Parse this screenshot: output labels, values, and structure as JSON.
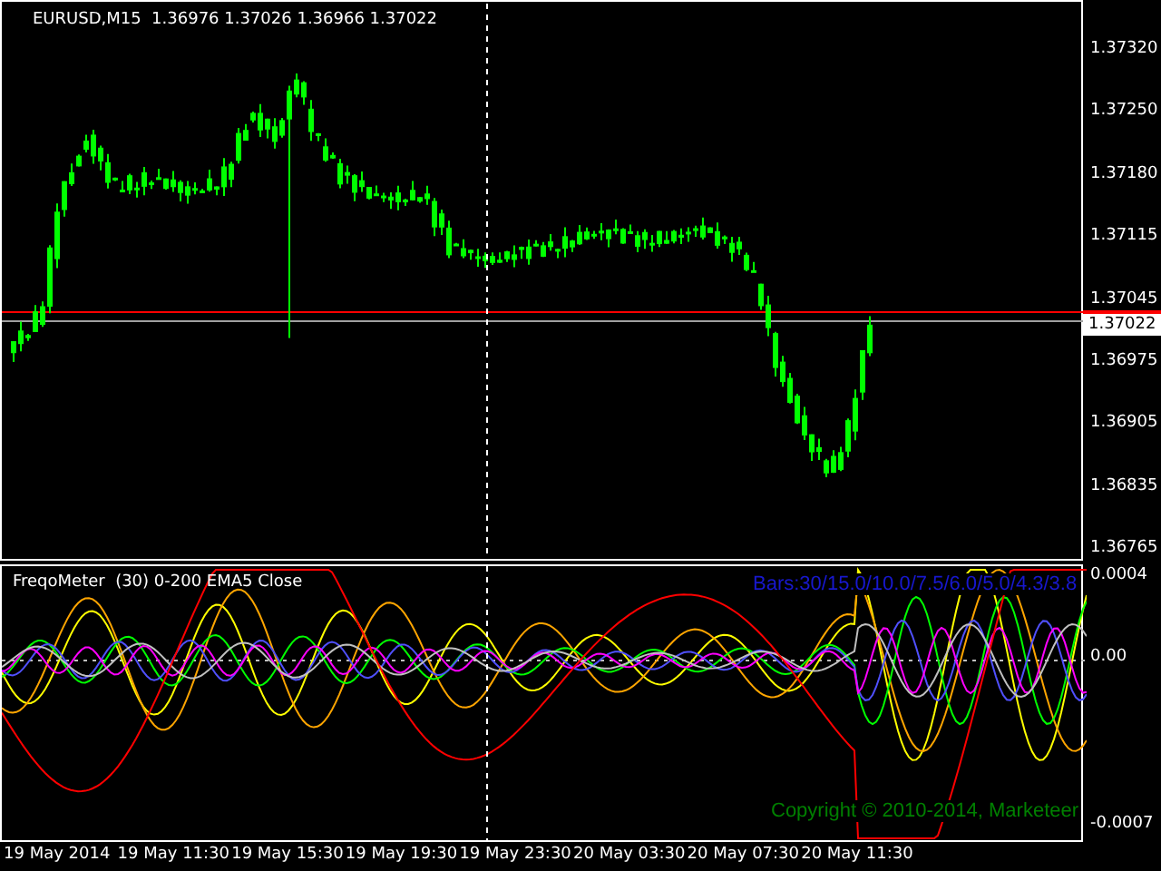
{
  "header": {
    "symbol": "EURUSD,M15",
    "open": "1.36976",
    "high": "1.37026",
    "low": "1.36966",
    "close": "1.37022"
  },
  "price_axis": {
    "ticks": [
      "1.37320",
      "1.37250",
      "1.37180",
      "1.37115",
      "1.37045",
      "1.36975",
      "1.36905",
      "1.36835",
      "1.36765"
    ],
    "current_price": "1.37022"
  },
  "indicator": {
    "title": "FreqoMeter  (30) 0-200 EMA5 Close",
    "bars_label": "Bars:30/15.0/10.0/7.5/6.0/5.0/4.3/3.8",
    "copyright": "Copyright © 2010-2014, Marketeer",
    "axis": [
      "0.0004",
      "0.00",
      "-0.0007"
    ]
  },
  "time_axis": [
    "19 May 2014",
    "19 May 11:30",
    "19 May 15:30",
    "19 May 19:30",
    "19 May 23:30",
    "20 May 03:30",
    "20 May 07:30",
    "20 May 11:30"
  ]
}
